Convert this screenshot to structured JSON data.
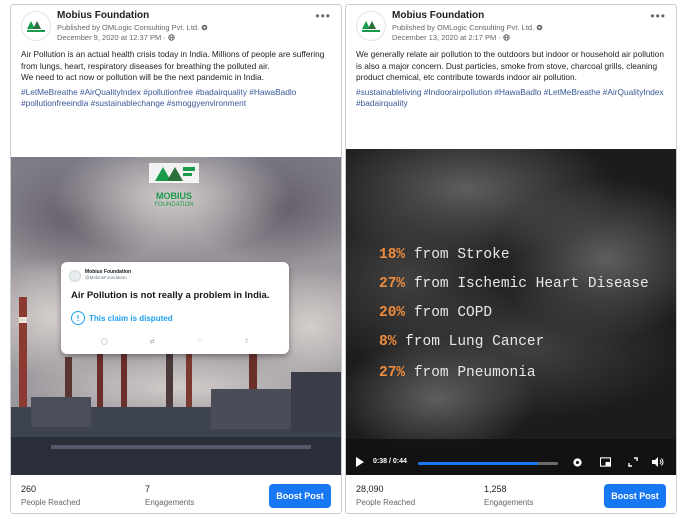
{
  "posts": [
    {
      "page_name": "Mobius Foundation",
      "publisher": "Published by OMLogic Consulting Pvt. Ltd.",
      "date": "December 9, 2020 at 12:37 PM",
      "body": [
        "Air Pollution is an actual health crisis today in India. Millions of people are suffering from lungs, heart, respiratory diseases for breathing the polluted air.",
        "We need to act now or pollution will be the next pandemic in India."
      ],
      "hashtags": "#LetMeBreathe #AirQualityIndex #pollutionfree #badairquality #HawaBadlo #pollutionfreeindia #sustainablechange #smoggyenvironment",
      "logo_text": "MOBIUS",
      "logo_sub": "FOUNDATION",
      "tweet_name": "Mobius Foundation",
      "tweet_handle": "@MobiusFoundation",
      "tweet_text": "Air Pollution is not really a problem in India.",
      "tweet_disputed": "This claim is disputed",
      "tweet_disputed_icon": "!",
      "reached_value": "260",
      "reached_label": "People Reached",
      "engagements_value": "7",
      "engagements_label": "Engagements",
      "boost_label": "Boost Post"
    },
    {
      "page_name": "Mobius Foundation",
      "publisher": "Published by OMLogic Consulting Pvt. Ltd.",
      "date": "December 13, 2020 at 2:17 PM",
      "body": [
        "We generally relate air pollution to the outdoors but indoor or household air pollution is also a major concern. Dust particles, smoke from stove, charcoal grills, cleaning product chemical, etc contribute towards indoor air pollution."
      ],
      "hashtags": "#sustainableliving #Indoorairpollution #HawaBadlo #LetMeBreathe #AirQualityIndex #badairquality",
      "video_stats": [
        {
          "pct": "18%",
          "text": "from Stroke"
        },
        {
          "pct": "27%",
          "text": "from Ischemic Heart Disease"
        },
        {
          "pct": "20%",
          "text": "from COPD"
        },
        {
          "pct": "8%",
          "text": "from Lung Cancer"
        },
        {
          "pct": "27%",
          "text": "from Pneumonia"
        }
      ],
      "video_time": "0:38 / 0:44",
      "video_progress": 0.86,
      "reached_value": "28,090",
      "reached_label": "People Reached",
      "engagements_value": "1,258",
      "engagements_label": "Engagements",
      "boost_label": "Boost Post"
    }
  ],
  "colors": {
    "brand_green": "#1a9b4b",
    "link_blue": "#385898",
    "boost_blue": "#1877f2",
    "stat_orange": "#f08d3c"
  },
  "icons": {
    "more": "more-options-icon",
    "globe": "globe-icon",
    "settings": "settings-icon",
    "miniplayer": "miniplayer-icon",
    "fullscreen": "fullscreen-icon",
    "volume": "volume-icon"
  }
}
